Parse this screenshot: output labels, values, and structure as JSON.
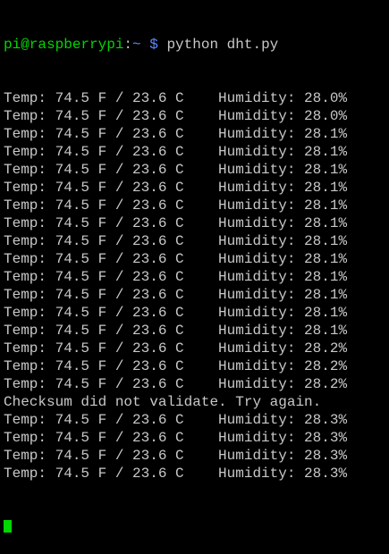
{
  "prompt": {
    "user_host": "pi@raspberrypi",
    "separator": ":",
    "path": "~",
    "symbol": " $",
    "command": " python dht.py"
  },
  "output_lines": [
    "Temp: 74.5 F / 23.6 C    Humidity: 28.0%",
    "Temp: 74.5 F / 23.6 C    Humidity: 28.0%",
    "Temp: 74.5 F / 23.6 C    Humidity: 28.1%",
    "Temp: 74.5 F / 23.6 C    Humidity: 28.1%",
    "Temp: 74.5 F / 23.6 C    Humidity: 28.1%",
    "Temp: 74.5 F / 23.6 C    Humidity: 28.1%",
    "Temp: 74.5 F / 23.6 C    Humidity: 28.1%",
    "Temp: 74.5 F / 23.6 C    Humidity: 28.1%",
    "Temp: 74.5 F / 23.6 C    Humidity: 28.1%",
    "Temp: 74.5 F / 23.6 C    Humidity: 28.1%",
    "Temp: 74.5 F / 23.6 C    Humidity: 28.1%",
    "Temp: 74.5 F / 23.6 C    Humidity: 28.1%",
    "Temp: 74.5 F / 23.6 C    Humidity: 28.1%",
    "Temp: 74.5 F / 23.6 C    Humidity: 28.1%",
    "Temp: 74.5 F / 23.6 C    Humidity: 28.2%",
    "Temp: 74.5 F / 23.6 C    Humidity: 28.2%",
    "Temp: 74.5 F / 23.6 C    Humidity: 28.2%",
    "Checksum did not validate. Try again.",
    "Temp: 74.5 F / 23.6 C    Humidity: 28.3%",
    "Temp: 74.5 F / 23.6 C    Humidity: 28.3%",
    "Temp: 74.5 F / 23.6 C    Humidity: 28.3%",
    "Temp: 74.5 F / 23.6 C    Humidity: 28.3%"
  ],
  "colors": {
    "background": "#000000",
    "text": "#c8c8c8",
    "user_host": "#00d700",
    "path": "#5f87ff",
    "cursor": "#00d700"
  }
}
